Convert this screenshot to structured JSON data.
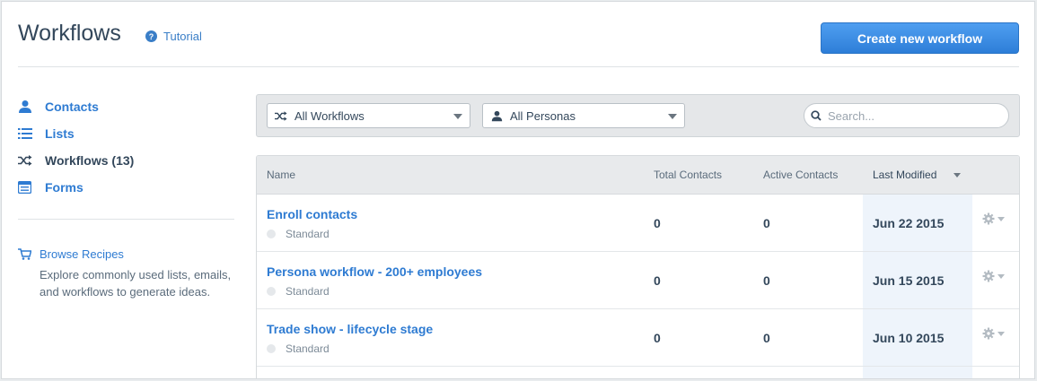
{
  "header": {
    "title": "Workflows",
    "tutorial_label": "Tutorial",
    "create_button": "Create new workflow"
  },
  "sidebar": {
    "items": [
      {
        "label": "Contacts",
        "icon": "person-icon"
      },
      {
        "label": "Lists",
        "icon": "list-icon"
      },
      {
        "label": "Workflows (13)",
        "icon": "shuffle-icon",
        "active": true
      },
      {
        "label": "Forms",
        "icon": "form-icon"
      }
    ],
    "recipes": {
      "label": "Browse Recipes",
      "description": "Explore commonly used lists, emails, and workflows to generate ideas."
    }
  },
  "filters": {
    "workflow_select": "All Workflows",
    "persona_select": "All Personas",
    "search_placeholder": "Search..."
  },
  "table": {
    "columns": [
      "Name",
      "Total Contacts",
      "Active Contacts",
      "Last Modified"
    ],
    "rows": [
      {
        "name": "Enroll contacts",
        "type": "Standard",
        "total": "0",
        "active": "0",
        "modified": "Jun 22 2015"
      },
      {
        "name": "Persona workflow - 200+ employees",
        "type": "Standard",
        "total": "0",
        "active": "0",
        "modified": "Jun 15 2015"
      },
      {
        "name": "Trade show - lifecycle stage",
        "type": "Standard",
        "total": "0",
        "active": "0",
        "modified": "Jun 10 2015"
      }
    ]
  },
  "colors": {
    "accent": "#2e7bd2",
    "button": "#3a8ee6",
    "highlight_column": "#eef4fb"
  }
}
